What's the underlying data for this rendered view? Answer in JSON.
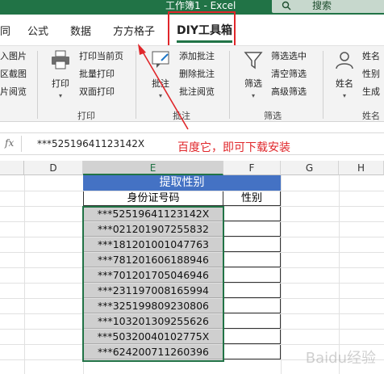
{
  "titlebar": {
    "title": "工作簿1 - Excel",
    "search_label": "搜索",
    "bg_color": "#217346"
  },
  "tabs": [
    {
      "label": "同"
    },
    {
      "label": "公式"
    },
    {
      "label": "数据"
    },
    {
      "label": "方方格子"
    },
    {
      "label": "DIY工具箱"
    }
  ],
  "ribbon": {
    "left_items": [
      "入图片",
      "区截图",
      "片阅览"
    ],
    "print": {
      "label": "打印",
      "items": [
        "打印当前页",
        "批量打印",
        "双面打印"
      ],
      "group": "打印"
    },
    "annotate": {
      "label": "批注",
      "items": [
        "添加批注",
        "删除批注",
        "批注阅览"
      ],
      "group": "批注"
    },
    "filter": {
      "label": "筛选",
      "items": [
        "筛选选中",
        "清空筛选",
        "高级筛选"
      ],
      "group": "筛选"
    },
    "name": {
      "label": "姓名",
      "items": [
        "姓名",
        "性别",
        "生成"
      ],
      "group": "姓名"
    }
  },
  "formula_bar": {
    "fx": "fx",
    "formula": "***52519641123142X"
  },
  "annotation": {
    "text": "百度它，即可下载安装",
    "color": "#e0262a"
  },
  "columns": [
    "D",
    "E",
    "F",
    "G",
    "H"
  ],
  "table": {
    "header": "提取性别",
    "col_id": "身份证号码",
    "col_sex": "性别",
    "header_color": "#4472c4",
    "rows": [
      "***52519641123142X",
      "***021201907255832",
      "***181201001047763",
      "***781201606188946",
      "***701201705046946",
      "***231197008165994",
      "***325199809230806",
      "***103201309255626",
      "***50320040102775X",
      "***624200711260396"
    ]
  },
  "watermark": "Baidu经验"
}
